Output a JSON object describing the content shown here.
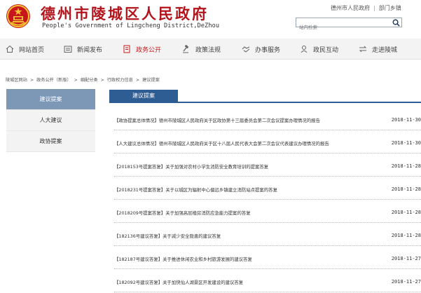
{
  "header": {
    "title": "德州市陵城区人民政府",
    "subtitle": "People's Government of Lingcheng District,DeZhou",
    "top_links": [
      "德州市人民政府",
      "部门乡镇"
    ],
    "search_placeholder": "站内检索"
  },
  "nav": {
    "items": [
      {
        "label": "网站首页",
        "icon": "home-icon"
      },
      {
        "label": "新闻发布",
        "icon": "news-icon"
      },
      {
        "label": "政务公开",
        "icon": "document-icon",
        "active": true
      },
      {
        "label": "政策法规",
        "icon": "gavel-icon"
      },
      {
        "label": "办事服务",
        "icon": "handshake-icon"
      },
      {
        "label": "政民互动",
        "icon": "person-icon"
      },
      {
        "label": "走进陵城",
        "icon": "arrows-icon"
      }
    ]
  },
  "breadcrumb": [
    "陵城区网站",
    "政务公开（新版）",
    "细配分类",
    "行政权力信息",
    "建议提案"
  ],
  "sidebar": {
    "items": [
      {
        "label": "建议提案",
        "active": true
      },
      {
        "label": "人大建议"
      },
      {
        "label": "政协提案"
      }
    ]
  },
  "main": {
    "tab_label": "建议提案",
    "list": [
      {
        "title": "【政协提案总体情况】德州市陵城区人民政府关于区政协第十三届委员会第二次会议提案办理情况的报告",
        "date": "2018-11-30"
      },
      {
        "title": "【人大建议总体情况】德州市陵城区人民政府关于区十八届人民代表大会第二次会议代表建议办理情况的报告",
        "date": "2018-11-30"
      },
      {
        "title": "【2018153号提案答复】关于加强对农村小学生消防安全教育培训的提案答复",
        "date": "2018-11-28"
      },
      {
        "title": "【2018231号提案答复】关于以城区为辐射中心偏远乡镇建立消防站点提案的答复",
        "date": "2018-11-28"
      },
      {
        "title": "【2018209号提案答复】关于加强高层楼房消防应急能力提案的答复",
        "date": "2018-11-28"
      },
      {
        "title": "【182136号建议答复】关于减少安全隐患的建议答复",
        "date": "2018-11-28"
      },
      {
        "title": "【182187号建议答复】关于推进休闲农业和乡村旅游发展的建议答复",
        "date": "2018-11-27"
      },
      {
        "title": "【182092号建议答复】关于加快仙人湖景区开发建设的建议答复",
        "date": "2018-11-27"
      }
    ]
  },
  "colors": {
    "brand_red": "#b3131a",
    "nav_active": "#c61c1c",
    "tab_blue": "#2e5d93",
    "sidebar_active": "#7d98b7"
  }
}
